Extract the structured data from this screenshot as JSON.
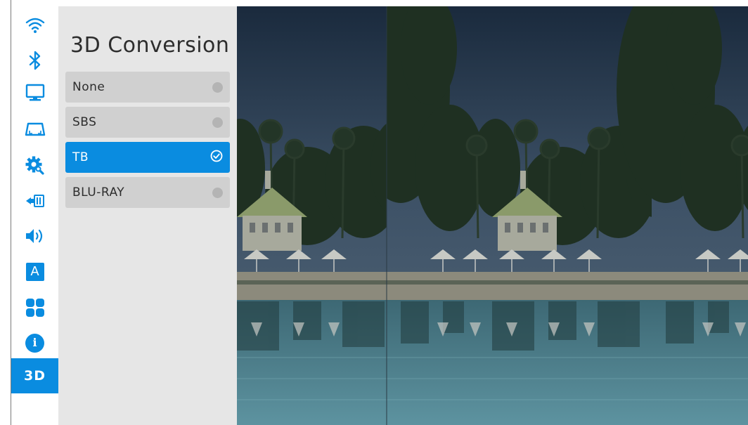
{
  "sidebar": {
    "items": [
      {
        "icon": "wifi-icon"
      },
      {
        "icon": "bluetooth-icon"
      },
      {
        "icon": "monitor-icon"
      },
      {
        "icon": "keystone-icon"
      },
      {
        "icon": "settings-gear-icon"
      },
      {
        "icon": "input-source-icon"
      },
      {
        "icon": "speaker-icon"
      },
      {
        "icon": "language-icon",
        "glyph": "A"
      },
      {
        "icon": "apps-icon"
      },
      {
        "icon": "info-icon",
        "glyph": "i"
      },
      {
        "icon": "3d-icon",
        "label": "3D",
        "active": true
      }
    ]
  },
  "panel": {
    "title": "3D Conversion",
    "options": [
      {
        "label": "None",
        "selected": false
      },
      {
        "label": "SBS",
        "selected": false
      },
      {
        "label": "TB",
        "selected": true
      },
      {
        "label": "BLU-RAY",
        "selected": false
      }
    ]
  },
  "colors": {
    "accent": "#0a8ce0",
    "panel_bg": "#e6e6e6",
    "option_bg": "#d0d0d0"
  }
}
